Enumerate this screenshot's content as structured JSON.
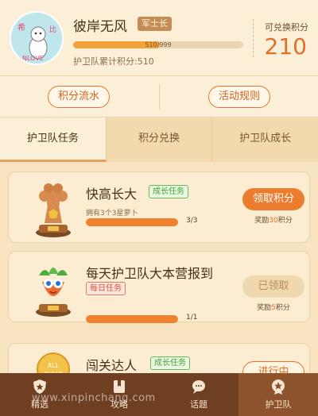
{
  "header": {
    "username": "彼岸无风",
    "rank": "军士长",
    "level_progress_text": "510/999",
    "level_progress": 0.51,
    "cumulative_points": "护卫队累计积分:510",
    "points_label": "可兑换积分",
    "points_value": "210",
    "avatar_text": "希 比 NLOVE"
  },
  "actions": {
    "points_flow": "积分流水",
    "activity_rules": "活动规则"
  },
  "tabs": [
    {
      "label": "护卫队任务",
      "active": true
    },
    {
      "label": "积分兑换",
      "active": false
    },
    {
      "label": "护卫队成长",
      "active": false
    }
  ],
  "tasks": [
    {
      "title": "快高长大",
      "tag": "成长任务",
      "description": "拥有3个3星萝卜",
      "progress_text": "3/3",
      "progress": 1.0,
      "button": "领取积分",
      "reward_prefix": "奖励",
      "reward_num": "30",
      "reward_suffix": "积分"
    },
    {
      "title": "每天护卫队大本营报到",
      "tag": "每日任务",
      "description": "",
      "progress_text": "1/1",
      "progress": 1.0,
      "button": "已领取",
      "reward_prefix": "奖励",
      "reward_num": "5",
      "reward_suffix": "积分"
    },
    {
      "title": "闯关达人",
      "tag": "成长任务",
      "trophy_text": "ALL CLEAR",
      "button": "进行中"
    }
  ],
  "nav": [
    {
      "label": "精选",
      "icon": "shield-star-icon",
      "active": false
    },
    {
      "label": "攻略",
      "icon": "bookmark-icon",
      "active": false
    },
    {
      "label": "话题",
      "icon": "chat-bubble-icon",
      "active": false
    },
    {
      "label": "护卫队",
      "icon": "guard-badge-icon",
      "active": true
    }
  ],
  "watermark": "www.xinpinchang.com",
  "colors": {
    "accent": "#e2702a",
    "background": "#f7e3bf",
    "nav_bg": "#6f3f22"
  }
}
